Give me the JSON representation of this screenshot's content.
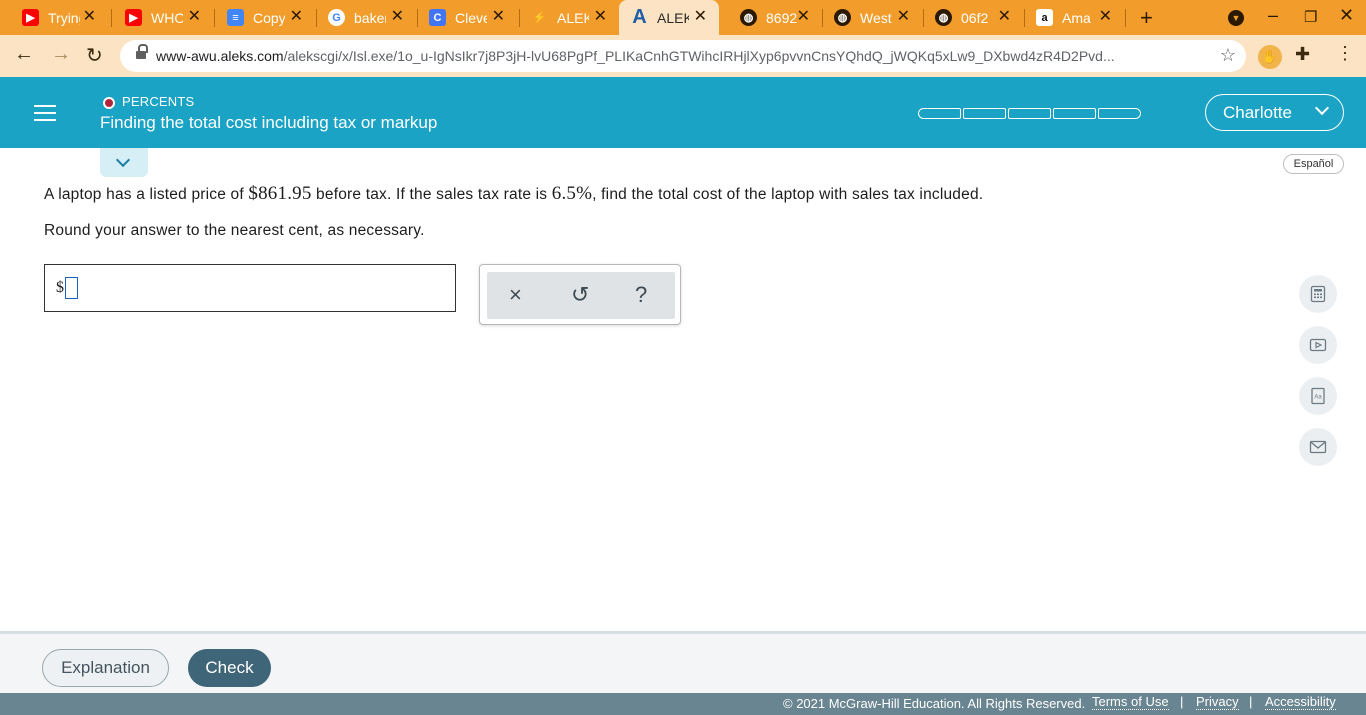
{
  "browser": {
    "tabs": [
      {
        "title": "Trying",
        "favicon": "youtube-icon",
        "color": "#ff0000"
      },
      {
        "title": "WHO",
        "favicon": "youtube-icon",
        "color": "#ff0000"
      },
      {
        "title": "Copy",
        "favicon": "docs-icon",
        "color": "#4285f4"
      },
      {
        "title": "baker",
        "favicon": "google-icon",
        "color": "#ffffff"
      },
      {
        "title": "Cleve",
        "favicon": "clever-icon",
        "color": "#4274f6"
      },
      {
        "title": "ALEK",
        "favicon": "aleks-icon",
        "color": "#e6c229"
      },
      {
        "title": "ALEK",
        "favicon": "aleks-a-icon",
        "color": "#1f5fa8",
        "active": true
      },
      {
        "title": "8692",
        "favicon": "globe-icon",
        "color": "#2b1a00"
      },
      {
        "title": "West",
        "favicon": "globe-icon",
        "color": "#2b1a00"
      },
      {
        "title": "06f2",
        "favicon": "globe-icon",
        "color": "#2b1a00"
      },
      {
        "title": "Ama",
        "favicon": "amazon-icon",
        "color": "#ffffff"
      }
    ],
    "url_domain": "www-awu.aleks.com",
    "url_path": "/alekscgi/x/Isl.exe/1o_u-IgNsIkr7j8P3jH-lvU68PgPf_PLIKaCnhGTWihcIRHjlXyp6pvvnCnsYQhdQ_jWQKq5xLw9_DXbwd4zR4D2Pvd..."
  },
  "header": {
    "topic": "PERCENTS",
    "title": "Finding the total cost including tax or markup",
    "user": "Charlotte",
    "progress_segments": 5,
    "progress_filled": 0
  },
  "lang_button": "Español",
  "question": {
    "part1": "A laptop has a listed price of ",
    "price": "$861.95",
    "part2": " before tax. If the sales tax rate is ",
    "rate": "6.5%",
    "part3": ", find the total cost of the laptop with sales tax included.",
    "instruction": "Round your answer to the nearest cent, as necessary.",
    "answer_prefix": "$"
  },
  "tools": {
    "clear": "×",
    "undo": "↺",
    "help": "?"
  },
  "footer": {
    "explanation": "Explanation",
    "check": "Check",
    "copyright": "© 2021 McGraw-Hill Education. All Rights Reserved.",
    "terms": "Terms of Use",
    "privacy": "Privacy",
    "accessibility": "Accessibility"
  },
  "colors": {
    "header": "#1ba3c6",
    "tabstrip": "#f29d2b",
    "check": "#3f6578"
  }
}
